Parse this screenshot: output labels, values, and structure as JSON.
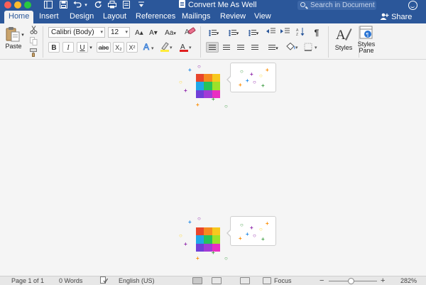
{
  "window": {
    "title": "Convert Me As Well",
    "search_placeholder": "Search in Document"
  },
  "tabs": [
    {
      "label": "Home",
      "active": true
    },
    {
      "label": "Insert"
    },
    {
      "label": "Design"
    },
    {
      "label": "Layout"
    },
    {
      "label": "References"
    },
    {
      "label": "Mailings"
    },
    {
      "label": "Review"
    },
    {
      "label": "View"
    }
  ],
  "share_label": "Share",
  "ribbon": {
    "paste_label": "Paste",
    "font_name": "Calibri (Body)",
    "font_size": "12",
    "bold": "B",
    "italic": "I",
    "underline": "U",
    "strikethrough": "abc",
    "subscript": "X₂",
    "superscript": "X²",
    "grow_font": "A▴",
    "shrink_font": "A▾",
    "change_case": "Aa",
    "styles_label": "Styles",
    "styles_pane_label": "Styles Pane",
    "highlight_color": "#ffeb3b",
    "font_color": "#e02020"
  },
  "document": {
    "grid_colors": [
      "#e8452c",
      "#f58a1f",
      "#f7c81e",
      "#1ea7e8",
      "#26c25a",
      "#9be22a",
      "#6f3fd8",
      "#a23bd6",
      "#e92ec2"
    ],
    "sparkle_colors": [
      "#e53935",
      "#43a047",
      "#1e88e5",
      "#fdd835",
      "#8e24aa",
      "#fb8c00"
    ]
  },
  "status": {
    "page": "Page 1 of 1",
    "words": "0 Words",
    "language": "English (US)",
    "focus": "Focus",
    "zoom_out": "−",
    "zoom_in": "+",
    "zoom_level": "282%",
    "zoom_fraction": 0.46
  }
}
